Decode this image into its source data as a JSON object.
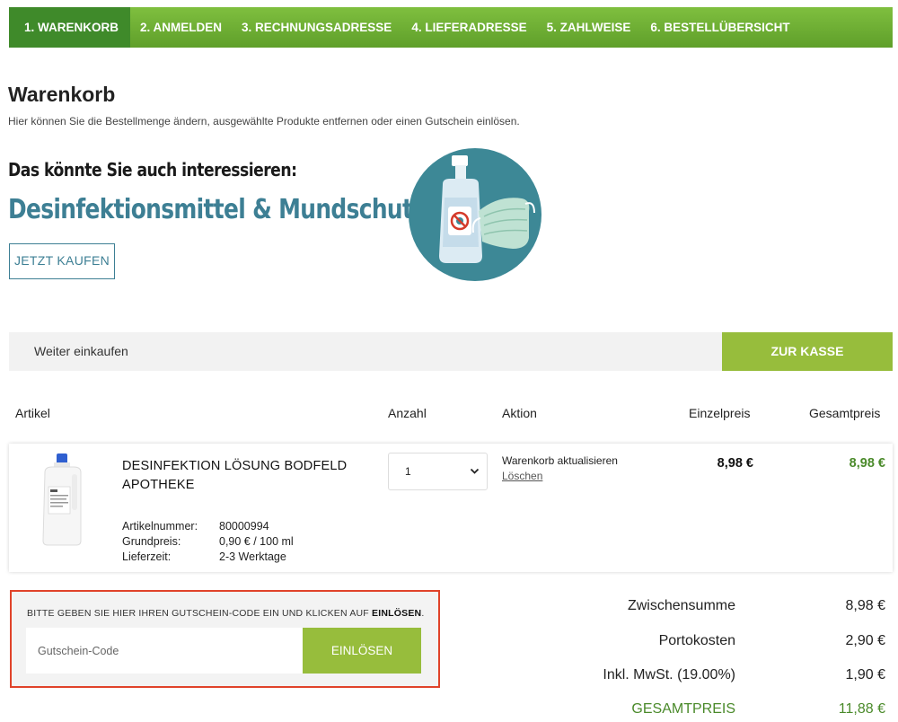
{
  "steps": [
    {
      "label": "1. WARENKORB"
    },
    {
      "label": "2. ANMELDEN"
    },
    {
      "label": "3. RECHNUNGSADRESSE"
    },
    {
      "label": "4. LIEFERADRESSE"
    },
    {
      "label": "5. ZAHLWEISE"
    },
    {
      "label": "6. BESTELLÜBERSICHT"
    }
  ],
  "page": {
    "title": "Warenkorb",
    "description": "Hier können Sie die Bestellmenge ändern, ausgewählte Produkte entfernen oder einen Gutschein einlösen."
  },
  "banner": {
    "heading": "Das könnte Sie auch interessieren:",
    "subheading": "Desinfektionsmittel & Mundschutz",
    "button": "JETZT KAUFEN",
    "icon": "sanitizer-mask-icon"
  },
  "actions": {
    "continue": "Weiter einkaufen",
    "checkout": "ZUR KASSE"
  },
  "columns": {
    "article": "Artikel",
    "quantity": "Anzahl",
    "action": "Aktion",
    "unit_price": "Einzelpreis",
    "total_price": "Gesamtpreis"
  },
  "item": {
    "name": "DESINFEKTION LÖSUNG BODFELD APOTHEKE",
    "article_number_label": "Artikelnummer:",
    "article_number": "80000994",
    "base_price_label": "Grundpreis:",
    "base_price": "0,90 € / 100 ml",
    "delivery_label": "Lieferzeit:",
    "delivery": "2-3 Werktage",
    "quantity": "1",
    "update": "Warenkorb aktualisieren",
    "delete": "Löschen",
    "unit_price": "8,98 €",
    "total_price": "8,98 €"
  },
  "coupon": {
    "hint": "BITTE GEBEN SIE HIER IHREN GUTSCHEIN-CODE EIN UND KLICKEN AUF ",
    "hint_bold": "EINLÖSEN",
    "hint_end": ".",
    "placeholder": "Gutschein-Code",
    "button": "EINLÖSEN"
  },
  "summary": {
    "subtotal_label": "Zwischensumme",
    "subtotal": "8,98 €",
    "shipping_label": "Portokosten",
    "shipping": "2,90 €",
    "vat_label": "Inkl. MwSt. (19.00%)",
    "vat": "1,90 €",
    "total_label": "GESAMTPREIS",
    "total": "11,88 €"
  },
  "colors": {
    "green": "#97bd3c",
    "dark_green": "#4a8a2a",
    "teal": "#3d7f94",
    "coupon_border": "#e0432a"
  }
}
